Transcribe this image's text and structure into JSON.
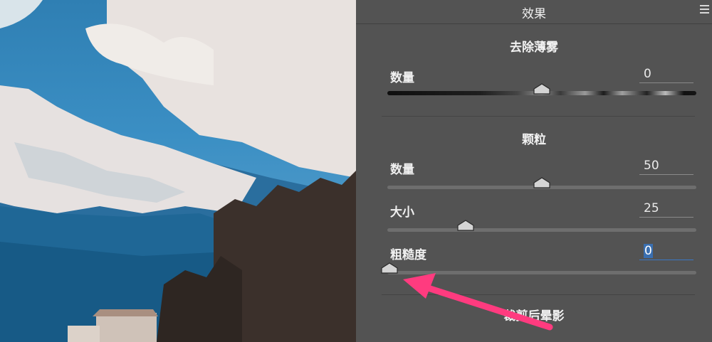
{
  "panel": {
    "title": "效果",
    "menu_icon": "hamburger-menu-icon"
  },
  "dehaze": {
    "title": "去除薄雾",
    "amount": {
      "label": "数量",
      "value": "0",
      "level": 0.5
    }
  },
  "grain": {
    "title": "颗粒",
    "amount": {
      "label": "数量",
      "value": "50",
      "level": 0.5
    },
    "size": {
      "label": "大小",
      "value": "25",
      "level": 0.25
    },
    "roughness": {
      "label": "粗糙度",
      "value": "0",
      "level": 0.0
    }
  },
  "vignette": {
    "title": "裁剪后晕影"
  },
  "colors": {
    "panel_bg": "#535353",
    "accent_blue": "#3a6fb0",
    "annotation_arrow": "#ff3b7f"
  }
}
